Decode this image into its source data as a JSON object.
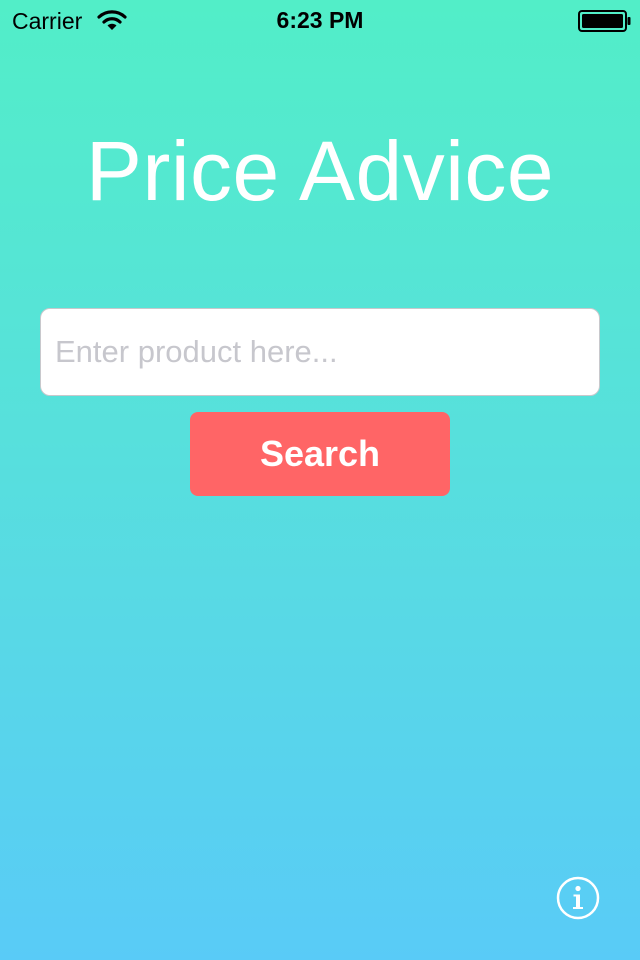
{
  "status_bar": {
    "carrier": "Carrier",
    "time": "6:23 PM",
    "wifi_icon": "wifi-icon",
    "battery_icon": "battery-icon"
  },
  "main": {
    "title": "Price Advice",
    "search": {
      "value": "",
      "placeholder": "Enter product here..."
    },
    "search_button_label": "Search",
    "info_icon": "info-icon"
  },
  "colors": {
    "background_top": "#52EEC8",
    "background_bottom": "#59CBF7",
    "button": "#FF6566",
    "title_text": "#FFFFFF"
  }
}
